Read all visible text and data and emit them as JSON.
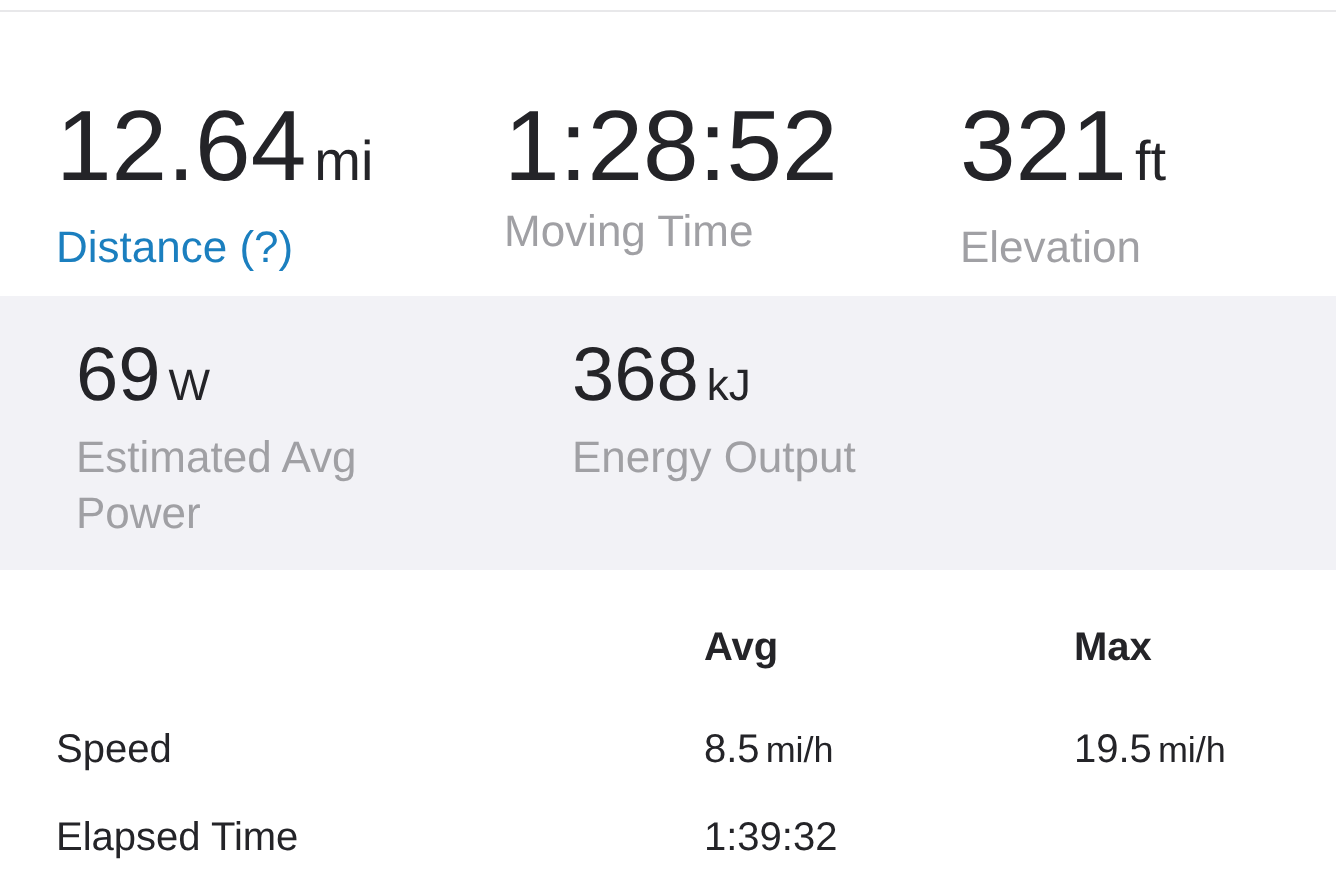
{
  "stats": [
    {
      "value": "12.64",
      "unit": "mi",
      "label": "Distance (?)",
      "kind": "link"
    },
    {
      "value": "1:28:52",
      "label": "Moving Time",
      "kind": "plain"
    },
    {
      "value": "321",
      "unit": "ft",
      "label": "Elevation",
      "kind": "plain"
    }
  ],
  "power": [
    {
      "value": "69",
      "unit": "W",
      "label": "Estimated Avg Power"
    },
    {
      "value": "368",
      "unit": "kJ",
      "label": "Energy Output"
    }
  ],
  "table": {
    "columns": [
      "Avg",
      "Max"
    ],
    "rows": [
      {
        "label": "Speed",
        "cells": [
          {
            "value": "8.5",
            "unit": "mi/h"
          },
          {
            "value": "19.5",
            "unit": "mi/h"
          }
        ]
      },
      {
        "label": "Elapsed Time",
        "cells": [
          {
            "value": "1:39:32"
          }
        ]
      }
    ]
  }
}
